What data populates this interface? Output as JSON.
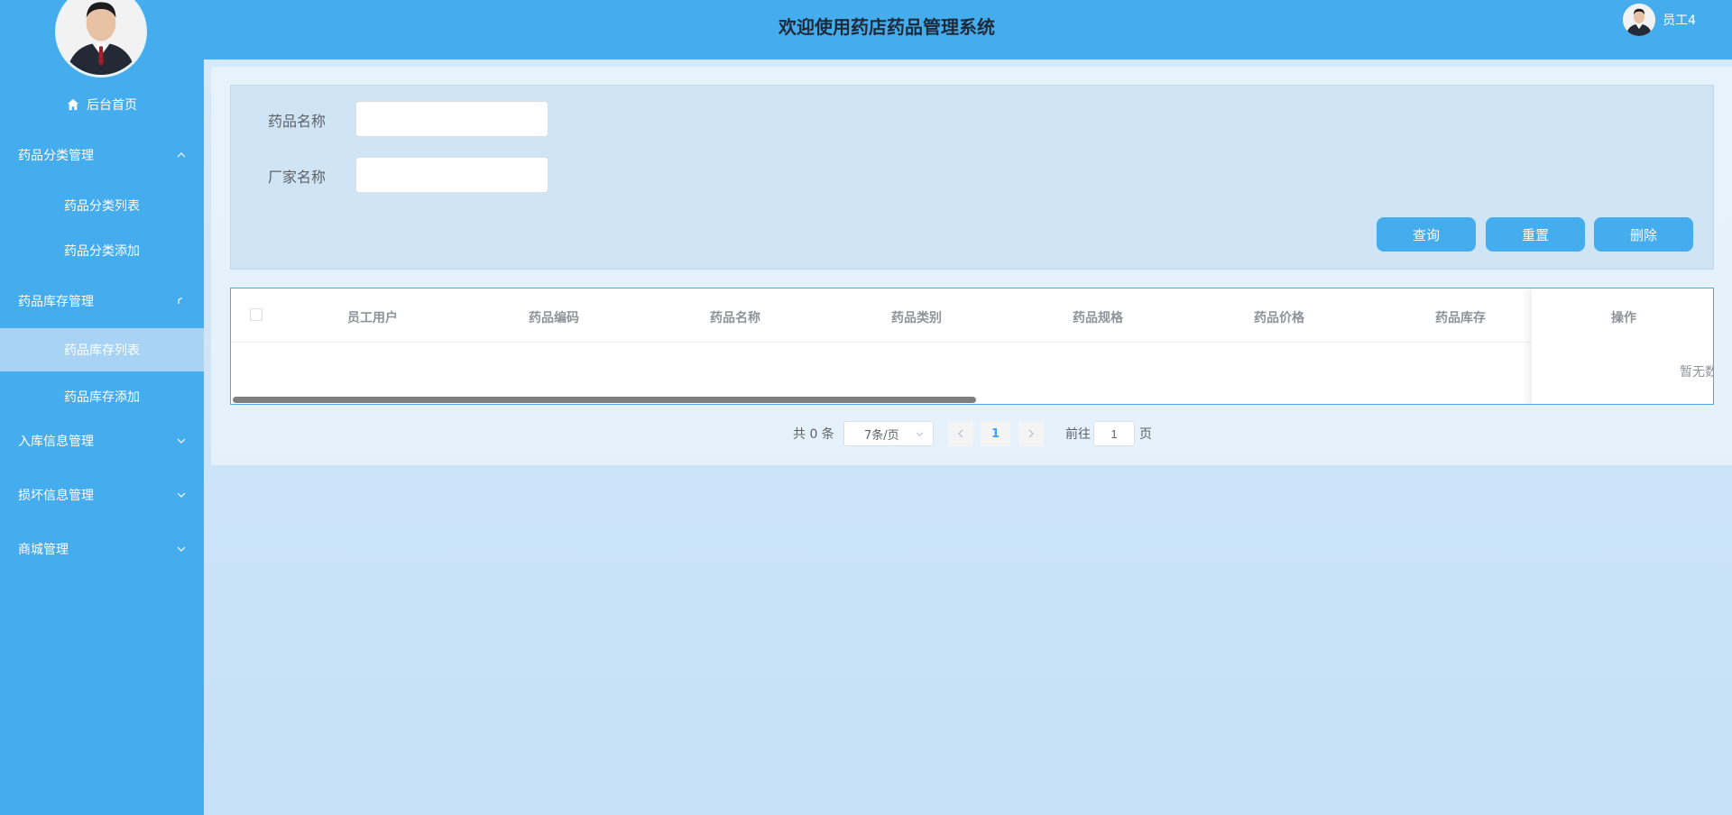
{
  "header": {
    "title": "欢迎使用药店药品管理系统",
    "username": "员工4"
  },
  "sidebar": {
    "home_label": "后台首页",
    "groups": [
      {
        "label": "药品分类管理",
        "expanded": true,
        "children": [
          "药品分类列表",
          "药品分类添加"
        ]
      },
      {
        "label": "药品库存管理",
        "expanded": true,
        "children": [
          "药品库存列表",
          "药品库存添加"
        ]
      },
      {
        "label": "入库信息管理",
        "expanded": false
      },
      {
        "label": "损坏信息管理",
        "expanded": false
      },
      {
        "label": "商城管理",
        "expanded": false
      }
    ],
    "active_item": "药品库存列表"
  },
  "search": {
    "fields": [
      {
        "label": "药品名称",
        "value": "",
        "placeholder": ""
      },
      {
        "label": "厂家名称",
        "value": "",
        "placeholder": ""
      }
    ],
    "buttons": [
      "查询",
      "重置",
      "删除"
    ]
  },
  "table": {
    "columns": [
      "员工用户",
      "药品编码",
      "药品名称",
      "药品类别",
      "药品规格",
      "药品价格",
      "药品库存"
    ],
    "action_column": "操作",
    "empty_text": "暂无数据",
    "rows": []
  },
  "pagination": {
    "total_text": "共 0 条",
    "page_size": "7条/页",
    "current_page": "1",
    "goto_prefix": "前往",
    "goto_value": "1",
    "goto_suffix": "页"
  },
  "colors": {
    "primary": "#45aced",
    "active_item_bg": "#a8d3f4",
    "header_title": "#1e2a38"
  }
}
